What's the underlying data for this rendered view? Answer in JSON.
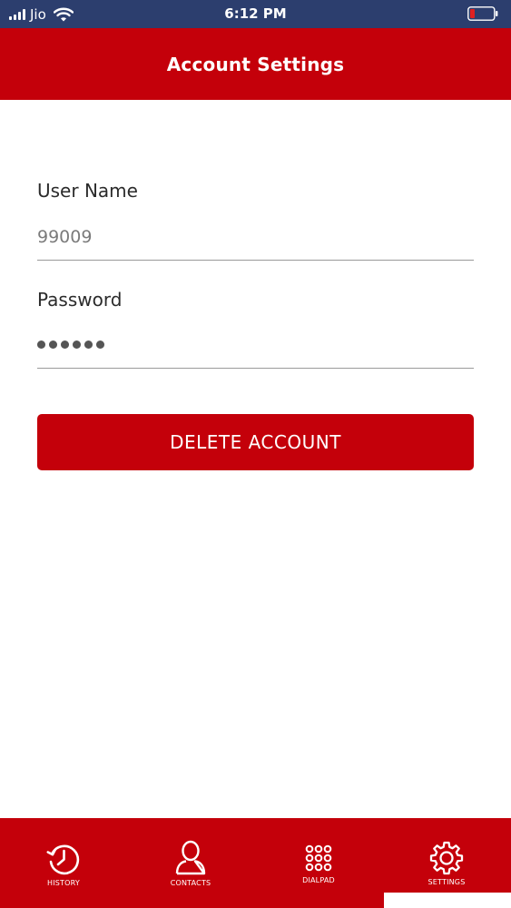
{
  "status_bar": {
    "carrier": "Jio",
    "time": "6:12 PM",
    "battery_color": "#e02020"
  },
  "header": {
    "title": "Account Settings"
  },
  "form": {
    "username_label": "User Name",
    "username_value": "99009",
    "password_label": "Password",
    "password_dots": 6
  },
  "actions": {
    "delete_label": "DELETE ACCOUNT"
  },
  "tabs": [
    {
      "label": "HISTORY",
      "icon": "history-icon"
    },
    {
      "label": "CONTACTS",
      "icon": "contacts-icon"
    },
    {
      "label": "DIALPAD",
      "icon": "dialpad-icon"
    },
    {
      "label": "SETTINGS",
      "icon": "settings-icon"
    }
  ],
  "colors": {
    "brand_red": "#c4000a",
    "status_bar_bg": "#2c3e6e"
  }
}
